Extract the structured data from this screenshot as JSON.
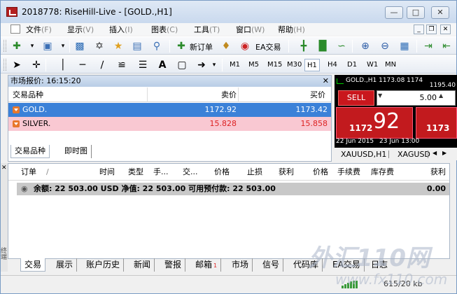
{
  "window": {
    "title": "2018778: RiseHill-Live - [GOLD.,H1]"
  },
  "menu": {
    "items": [
      {
        "label": "文件",
        "key": "(F)"
      },
      {
        "label": "显示",
        "key": "(V)"
      },
      {
        "label": "插入",
        "key": "(I)"
      },
      {
        "label": "图表",
        "key": "(C)"
      },
      {
        "label": "工具",
        "key": "(T)"
      },
      {
        "label": "窗口",
        "key": "(W)"
      },
      {
        "label": "帮助",
        "key": "(H)"
      }
    ]
  },
  "toolbar": {
    "new_order_label": "新订单",
    "ea_trade_label": "EA交易",
    "timeframes": [
      "M1",
      "M5",
      "M15",
      "M30",
      "H1",
      "H4",
      "D1",
      "W1",
      "MN"
    ],
    "active_timeframe": "H1"
  },
  "market_watch": {
    "title": "市场报价: 16:15:20",
    "columns": {
      "symbol": "交易品种",
      "bid": "卖价",
      "ask": "买价"
    },
    "rows": [
      {
        "symbol": "GOLD.",
        "bid": "1172.92",
        "ask": "1173.42"
      },
      {
        "symbol": "SILVER.",
        "bid": "15.828",
        "ask": "15.858"
      }
    ],
    "tabs": [
      "交易品种",
      "即时图"
    ]
  },
  "chart": {
    "title": "GOLD.,H1",
    "prices": "1173.08 1174",
    "right_price": "1195.40",
    "sell_label": "SELL",
    "lot": "5.00",
    "sell_small": "1172",
    "sell_big": "92",
    "buy_small": "1173",
    "date1": "22 Jun 2015",
    "date2": "23 Jun 13:00",
    "tabs": [
      "XAUUSD,H1",
      "XAGUSD"
    ]
  },
  "terminal": {
    "columns": [
      "订单",
      "/",
      "时间",
      "类型",
      "手...",
      "交...",
      "价格",
      "止损",
      "获利",
      "价格",
      "手续费",
      "库存费",
      "获利"
    ],
    "summary": "余额: 22 503.00 USD  净值: 22 503.00  可用预付款: 22 503.00",
    "summary_value": "0.00",
    "side_label": "终端"
  },
  "bottom_tabs": [
    "交易",
    "展示",
    "账户历史",
    "新闻",
    "警报",
    "邮箱",
    "市场",
    "信号",
    "代码库",
    "EA交易",
    "日志"
  ],
  "mail_count": "1",
  "status": {
    "traffic": "615/20 kb"
  },
  "watermark": "外汇110网",
  "watermark2": "www.fx110.com",
  "colors": {
    "sell_red": "#c21a1e",
    "selection_blue": "#3b81d8",
    "silver_pink": "#f9c8d2"
  }
}
